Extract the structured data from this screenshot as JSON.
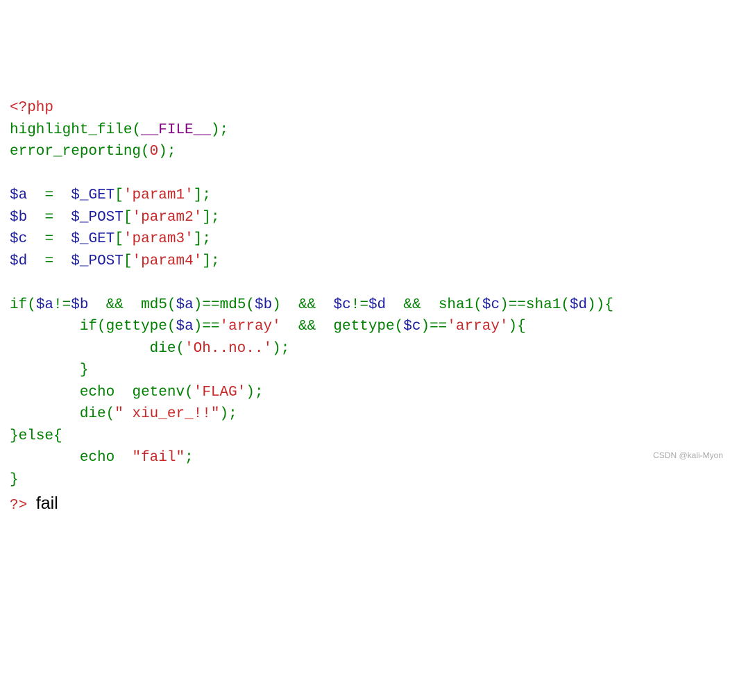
{
  "phpOpenTag": "<?php",
  "line2": {
    "func": "highlight_file",
    "constant": "__FILE__"
  },
  "line3": {
    "func": "error_reporting",
    "arg": "0"
  },
  "assigns": {
    "a": {
      "var": "$a",
      "eq": "=",
      "super": "$_GET",
      "key": "param1"
    },
    "b": {
      "var": "$b",
      "eq": "=",
      "super": "$_POST",
      "key": "param2"
    },
    "c": {
      "var": "$c",
      "eq": "=",
      "super": "$_GET",
      "key": "param3"
    },
    "d": {
      "var": "$d",
      "eq": "=",
      "super": "$_POST",
      "key": "param4"
    }
  },
  "condition": {
    "if": "if",
    "a": "$a",
    "neq1": "!=",
    "b": "$b",
    "and": "&&",
    "md5": "md5",
    "eqeq": "==",
    "c": "$c",
    "neq2": "!=",
    "d": "$d",
    "sha1": "sha1"
  },
  "inner": {
    "if": "if",
    "gettype": "gettype",
    "eqeq": "==",
    "arrayStr": "array",
    "and": "&&",
    "die": "die",
    "ohno": "Oh..no.."
  },
  "echo1": {
    "echo": "echo",
    "getenv": "getenv",
    "flag": "FLAG"
  },
  "die2": {
    "die": "die",
    "msg": " xiu_er_!!"
  },
  "elseBlock": {
    "else": "else",
    "echo": "echo",
    "msg": "fail"
  },
  "phpCloseTag": "?>",
  "outputText": "fail",
  "watermark": "CSDN @kali-Myon"
}
